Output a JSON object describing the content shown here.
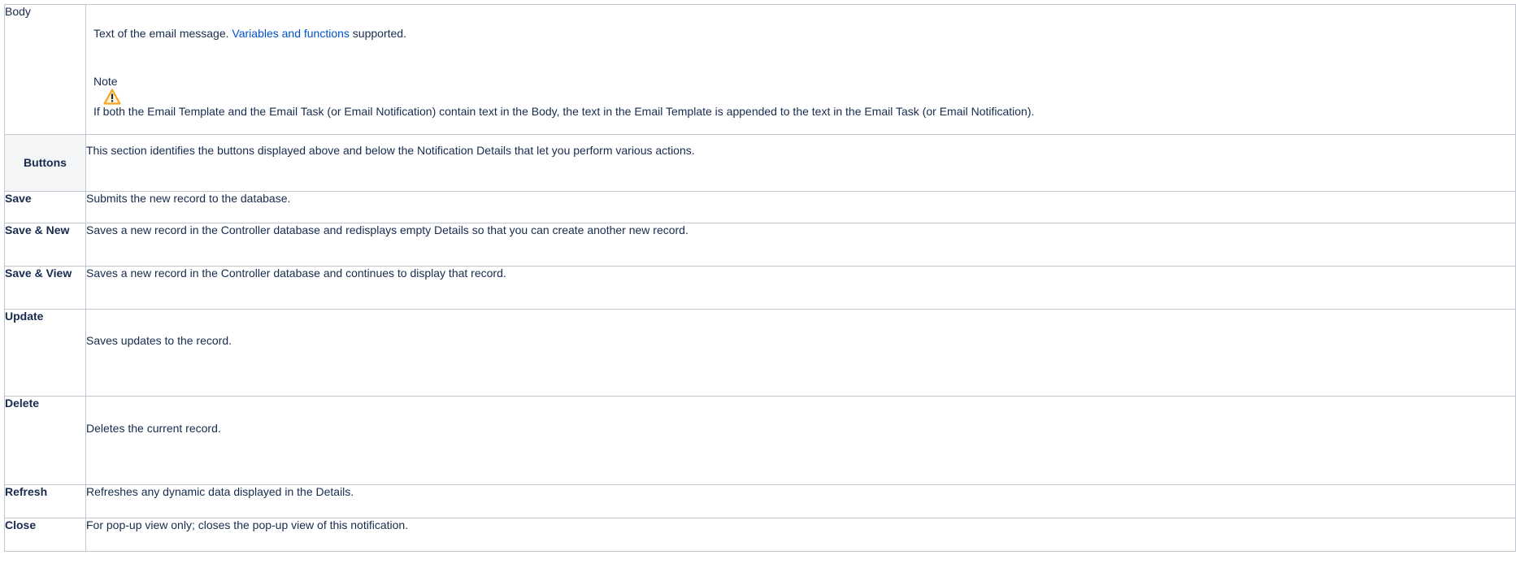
{
  "rows": {
    "body": {
      "label": "Body",
      "description_before_link": "Text of the email message. ",
      "description_link": "Variables and functions",
      "description_after_link": " supported.",
      "note_title": "Note",
      "note_icon": "warning-icon",
      "note_text": "If both the Email Template and the Email Task (or Email Notification) contain text in the Body, the text in the Email Template is appended to the text in the Email Task (or Email Notification)."
    },
    "buttons": {
      "label": "Buttons",
      "description": "This section identifies the buttons displayed above and below the Notification Details that let you perform various actions."
    },
    "save": {
      "label": "Save",
      "description": "Submits the new record to the database."
    },
    "save_new": {
      "label": "Save & New",
      "description": "Saves a new record in the Controller database and redisplays empty Details so that you can create another new record."
    },
    "save_view": {
      "label": "Save & View",
      "description": "Saves a new record in the Controller database and continues to display that record."
    },
    "update": {
      "label": "Update",
      "description": "Saves updates to the record."
    },
    "delete": {
      "label": "Delete",
      "description": "Deletes the current record."
    },
    "refresh": {
      "label": "Refresh",
      "description": "Refreshes any dynamic data displayed in the Details."
    },
    "close": {
      "label": "Close",
      "description": "For pop-up view only; closes the pop-up view of this notification."
    }
  },
  "colors": {
    "link": "#0052cc",
    "warning": "#f5a623",
    "border": "#c1c7d0",
    "header_bg": "#f4f5f7"
  }
}
